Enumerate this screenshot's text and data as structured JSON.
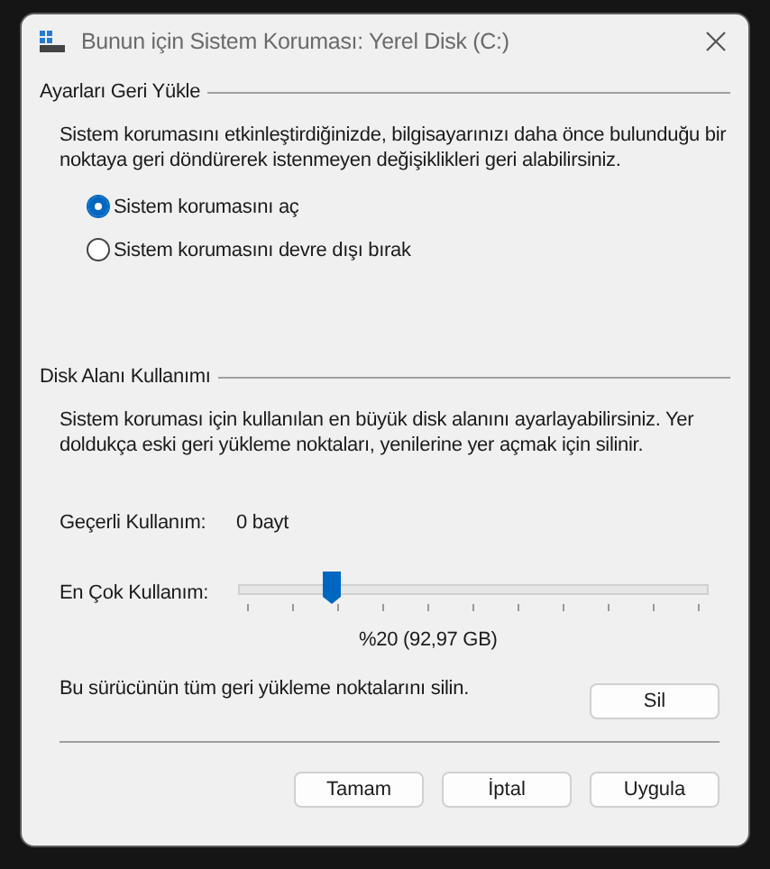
{
  "window": {
    "title": "Bunun için Sistem Koruması: Yerel Disk (C:)"
  },
  "restore": {
    "heading": "Ayarları Geri Yükle",
    "description": "Sistem korumasını etkinleştirdiğinizde, bilgisayarınızı daha önce bulunduğu bir noktaya geri döndürerek istenmeyen değişiklikleri geri alabilirsiniz.",
    "options": [
      {
        "label": "Sistem korumasını aç",
        "selected": true
      },
      {
        "label": "Sistem korumasını devre dışı bırak",
        "selected": false
      }
    ]
  },
  "disk": {
    "heading": "Disk Alanı Kullanımı",
    "description": "Sistem koruması için kullanılan en büyük disk alanını ayarlayabilirsiniz. Yer doldukça eski geri yükleme noktaları, yenilerine yer açmak için silinir.",
    "current_label": "Geçerli Kullanım:",
    "current_value": "0 bayt",
    "max_label": "En Çok Kullanım:",
    "max_slider": {
      "level": 0.2
    },
    "max_reading": "%20 (92,97 GB)",
    "delete_text": "Bu sürücünün tüm geri yükleme noktalarını silin.",
    "delete_button": "Sil"
  },
  "buttons": [
    "Tamam",
    "İptal",
    "Uygula"
  ]
}
